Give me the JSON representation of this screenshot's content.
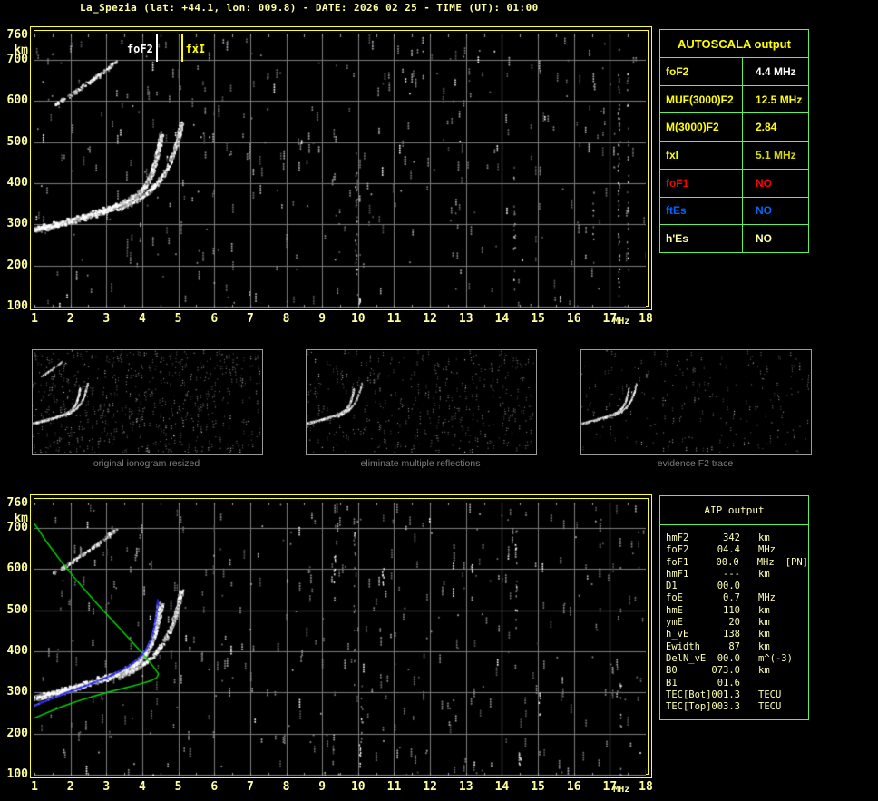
{
  "title": "La_Spezia (lat: +44.1, lon: 009.8) - DATE: 2026 02 25 - TIME (UT): 01:00",
  "colors": {
    "frame": "#ffff2a",
    "axis_text": "#ffff9e",
    "grid": "#7d7d7d",
    "table_border": "#5df05d",
    "autoscala_header": "#ffff00",
    "aip_text": "#ffffb4",
    "thumb_border": "#9a9a9a",
    "caption": "#7f7f7f",
    "profile_green": "#00dd00",
    "trace_blue": "#2323e8"
  },
  "axes": {
    "x_ticks": [
      "1",
      "2",
      "3",
      "4",
      "5",
      "6",
      "7",
      "8",
      "9",
      "10",
      "11",
      "12",
      "13",
      "14",
      "15",
      "16",
      "17",
      "18"
    ],
    "x_unit": "MHz",
    "y_labels": [
      {
        "text": "760",
        "km": 760
      },
      {
        "text": "km",
        "km": 722
      },
      {
        "text": "700",
        "km": 700
      },
      {
        "text": "600",
        "km": 600
      },
      {
        "text": "500",
        "km": 500
      },
      {
        "text": "400",
        "km": 400
      },
      {
        "text": "300",
        "km": 300
      },
      {
        "text": "200",
        "km": 200
      },
      {
        "text": "100",
        "km": 100
      }
    ]
  },
  "autoscala": {
    "header": "AUTOSCALA output",
    "rows": [
      {
        "label": "foF2",
        "value": "4.4 MHz",
        "label_color": "#ffff00",
        "value_color": "#ffffff"
      },
      {
        "label": "MUF(3000)F2",
        "value": "12.5 MHz",
        "label_color": "#ffff00",
        "value_color": "#ffff00"
      },
      {
        "label": "M(3000)F2",
        "value": "2.84",
        "label_color": "#ffff00",
        "value_color": "#ffff00"
      },
      {
        "label": "fxI",
        "value": "5.1 MHz",
        "label_color": "#ffff00",
        "value_color": "#d8d800"
      },
      {
        "label": "foF1",
        "value": "NO",
        "label_color": "#ff0000",
        "value_color": "#ff0000"
      },
      {
        "label": "ftEs",
        "value": "NO",
        "label_color": "#0066ff",
        "value_color": "#0066ff"
      },
      {
        "label": "h'Es",
        "value": "NO",
        "label_color": "#ffffa0",
        "value_color": "#ffffa0"
      }
    ]
  },
  "thumbnails": [
    {
      "caption": "original ionogram resized"
    },
    {
      "caption": "eliminate multiple reflections"
    },
    {
      "caption": "evidence F2 trace"
    }
  ],
  "aip": {
    "header": "AIP output",
    "rows": [
      {
        "label": "hmF2",
        "value": "342",
        "unit": "km",
        "note": ""
      },
      {
        "label": "foF2",
        "value": "04.4",
        "unit": "MHz",
        "note": ""
      },
      {
        "label": "foF1",
        "value": "00.0",
        "unit": "MHz",
        "note": "[PN]"
      },
      {
        "label": "hmF1",
        "value": "---",
        "unit": "km",
        "note": ""
      },
      {
        "label": "D1",
        "value": "00.0",
        "unit": "",
        "note": ""
      },
      {
        "label": "foE",
        "value": "0.7",
        "unit": "MHz",
        "note": ""
      },
      {
        "label": "hmE",
        "value": "110",
        "unit": "km",
        "note": ""
      },
      {
        "label": "ymE",
        "value": "20",
        "unit": "km",
        "note": ""
      },
      {
        "label": "h_vE",
        "value": "138",
        "unit": "km",
        "note": ""
      },
      {
        "label": "Ewidth",
        "value": "87",
        "unit": "km",
        "note": ""
      },
      {
        "label": "DelN_vE",
        "value": "00.0",
        "unit": "m^(-3)",
        "note": ""
      },
      {
        "label": "B0",
        "value": "073.0",
        "unit": "km",
        "note": ""
      },
      {
        "label": "B1",
        "value": "01.6",
        "unit": "",
        "note": ""
      },
      {
        "label": "TEC[Bot]",
        "value": "001.3",
        "unit": "TECU",
        "note": ""
      },
      {
        "label": "TEC[Top]",
        "value": "003.3",
        "unit": "TECU",
        "note": ""
      }
    ]
  },
  "chart_data": {
    "type": "scatter",
    "x": {
      "label": "MHz",
      "min": 1,
      "max": 18
    },
    "y": {
      "label": "km",
      "min": 100,
      "max": 760
    },
    "grid": {
      "x_step": 1,
      "y_step": 100,
      "color": "#7d7d7d",
      "on": true
    },
    "noise_palette": [
      "#5c5c5c",
      "#777777",
      "#949494",
      "#bdbdbd",
      "#ffffff"
    ],
    "traces": {
      "f2_o": {
        "points": [
          [
            1.0,
            289
          ],
          [
            1.4,
            297
          ],
          [
            1.9,
            309
          ],
          [
            2.4,
            321
          ],
          [
            2.9,
            334
          ],
          [
            3.3,
            347
          ],
          [
            3.6,
            360
          ],
          [
            3.9,
            378
          ],
          [
            4.1,
            400
          ],
          [
            4.25,
            425
          ],
          [
            4.35,
            455
          ],
          [
            4.45,
            490
          ],
          [
            4.52,
            520
          ]
        ],
        "width_km": 16,
        "density": 1050
      },
      "f2_x": {
        "points": [
          [
            3.3,
            337
          ],
          [
            3.7,
            354
          ],
          [
            4.0,
            370
          ],
          [
            4.3,
            392
          ],
          [
            4.55,
            420
          ],
          [
            4.75,
            452
          ],
          [
            4.9,
            487
          ],
          [
            5.0,
            520
          ],
          [
            5.08,
            552
          ]
        ],
        "width_km": 12,
        "density": 340
      },
      "hop": {
        "points": [
          [
            1.55,
            594
          ],
          [
            1.9,
            612
          ],
          [
            2.3,
            636
          ],
          [
            2.7,
            660
          ],
          [
            3.0,
            680
          ],
          [
            3.25,
            700
          ]
        ],
        "width_km": 9,
        "density": 140
      }
    },
    "curves": {
      "profile": {
        "color": "#00dd00",
        "dotted": false,
        "points": [
          [
            1.0,
            711
          ],
          [
            1.35,
            665
          ],
          [
            1.75,
            618
          ],
          [
            2.2,
            570
          ],
          [
            2.65,
            525
          ],
          [
            3.1,
            482
          ],
          [
            3.5,
            444
          ],
          [
            3.85,
            410
          ],
          [
            4.15,
            380
          ],
          [
            4.35,
            358
          ],
          [
            4.45,
            345
          ],
          [
            4.4,
            336
          ],
          [
            4.25,
            329
          ],
          [
            3.95,
            321
          ],
          [
            3.55,
            312
          ],
          [
            3.1,
            302
          ],
          [
            2.65,
            291
          ],
          [
            2.2,
            279
          ],
          [
            1.75,
            265
          ],
          [
            1.35,
            251
          ],
          [
            1.0,
            238
          ]
        ]
      },
      "autotrace": {
        "color": "#2323e8",
        "dotted": true,
        "points": [
          [
            1.0,
            268
          ],
          [
            1.5,
            286
          ],
          [
            2.0,
            303
          ],
          [
            2.5,
            319
          ],
          [
            3.0,
            336
          ],
          [
            3.35,
            351
          ],
          [
            3.65,
            366
          ],
          [
            3.9,
            383
          ],
          [
            4.1,
            404
          ],
          [
            4.25,
            430
          ],
          [
            4.34,
            462
          ],
          [
            4.4,
            495
          ],
          [
            4.43,
            525
          ]
        ]
      }
    },
    "plots": [
      {
        "id": "top",
        "seed": 1337,
        "noise_runs": 400,
        "traces": [
          "f2_o",
          "f2_x",
          "hop"
        ],
        "curves": [],
        "markers": [
          {
            "name": "foF2",
            "f": 4.4,
            "color": "#ffffff",
            "side": "left"
          },
          {
            "name": "fxI",
            "f": 5.1,
            "color": "#ffff00",
            "side": "right"
          }
        ],
        "columns": [
          {
            "f": 9.95,
            "km0": 160,
            "km1": 480,
            "n": 24,
            "bright": false
          },
          {
            "f": 10.05,
            "km0": 100,
            "km1": 125,
            "n": 5,
            "bright": true
          },
          {
            "f": 14.35,
            "km0": 130,
            "km1": 520,
            "n": 20,
            "bright": false
          },
          {
            "f": 16.55,
            "km0": 190,
            "km1": 420,
            "n": 9,
            "bright": false
          },
          {
            "f": 17.25,
            "km0": 120,
            "km1": 730,
            "n": 46,
            "bright": false
          },
          {
            "f": 17.5,
            "km0": 140,
            "km1": 700,
            "n": 26,
            "bright": false
          }
        ]
      },
      {
        "id": "bottom",
        "seed": 4242,
        "noise_runs": 430,
        "traces": [
          "f2_o",
          "f2_x",
          "hop"
        ],
        "curves": [
          "profile",
          "autotrace"
        ],
        "markers": [],
        "columns": [
          {
            "f": 9.35,
            "km0": 570,
            "km1": 640,
            "n": 8,
            "bright": true
          },
          {
            "f": 9.9,
            "km0": 300,
            "km1": 700,
            "n": 18,
            "bright": false
          },
          {
            "f": 10.05,
            "km0": 100,
            "km1": 180,
            "n": 8,
            "bright": true
          },
          {
            "f": 10.1,
            "km0": 140,
            "km1": 320,
            "n": 10,
            "bright": false
          },
          {
            "f": 10.7,
            "km0": 560,
            "km1": 620,
            "n": 7,
            "bright": true
          },
          {
            "f": 14.4,
            "km0": 390,
            "km1": 700,
            "n": 16,
            "bright": false
          },
          {
            "f": 14.5,
            "km0": 110,
            "km1": 160,
            "n": 6,
            "bright": true
          },
          {
            "f": 15.05,
            "km0": 240,
            "km1": 300,
            "n": 6,
            "bright": true
          },
          {
            "f": 17.3,
            "km0": 100,
            "km1": 330,
            "n": 12,
            "bright": false
          }
        ]
      }
    ],
    "thumbnails": [
      {
        "seed": 7,
        "noise_dots": 650,
        "trace_scale": 0.45,
        "traces": [
          "f2_o",
          "f2_x",
          "hop"
        ]
      },
      {
        "seed": 8,
        "noise_dots": 420,
        "trace_scale": 0.4,
        "traces": [
          "f2_o",
          "f2_x"
        ]
      },
      {
        "seed": 9,
        "noise_dots": 230,
        "trace_scale": 0.3,
        "traces": [
          "f2_o",
          "f2_x"
        ]
      }
    ]
  }
}
